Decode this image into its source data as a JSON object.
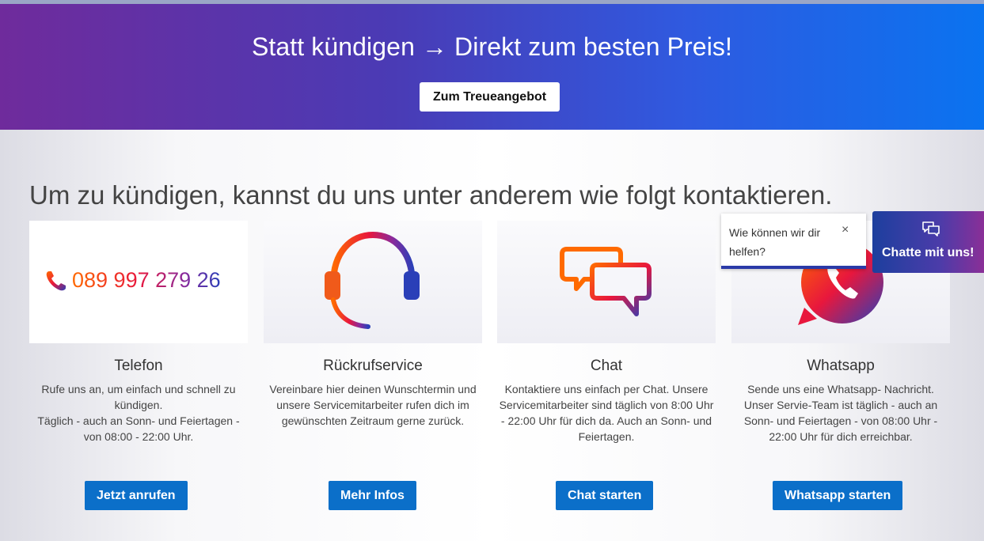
{
  "banner": {
    "title": "Statt kündigen → Direkt zum besten Preis!",
    "button": "Zum Treueangebot"
  },
  "main": {
    "heading": "Um zu kündigen, kannst du uns unter anderem wie folgt kontaktieren."
  },
  "cards": [
    {
      "title": "Telefon",
      "text": "Rufe uns an, um einfach und schnell zu kündigen.\nTäglich - auch an Sonn- und Feiertagen - von 08:00 - 22:00 Uhr.",
      "button": "Jetzt anrufen",
      "phone": "089 997 279 26",
      "icon": "phone-icon"
    },
    {
      "title": "Rückrufservice",
      "text": "Vereinbare hier deinen Wunschtermin und unsere Servicemitarbeiter rufen dich im gewünschten Zeitraum gerne zurück.",
      "button": "Mehr Infos",
      "icon": "headset-icon"
    },
    {
      "title": "Chat",
      "text": "Kontaktiere uns einfach per Chat. Unsere Servicemitarbeiter sind täglich von 8:00 Uhr - 22:00 Uhr für dich da. Auch an Sonn- und Feiertagen.",
      "button": "Chat starten",
      "icon": "chat-bubbles-icon"
    },
    {
      "title": "Whatsapp",
      "text": "Sende uns eine Whatsapp- Nachricht. Unser Servie-Team ist täglich - auch an Sonn- und Feiertagen - von 08:00 Uhr - 22:00 Uhr für dich erreichbar.",
      "button": "Whatsapp starten",
      "icon": "whatsapp-icon"
    }
  ],
  "chat_popup": {
    "text": "Wie können wir dir helfen?",
    "close": "×"
  },
  "chat_widget": {
    "label": "Chatte mit uns!",
    "icon": "chat-icon"
  },
  "colors": {
    "primary_button": "#0b6fc9",
    "banner_start": "#6f2b9c",
    "banner_end": "#0a73f0"
  }
}
